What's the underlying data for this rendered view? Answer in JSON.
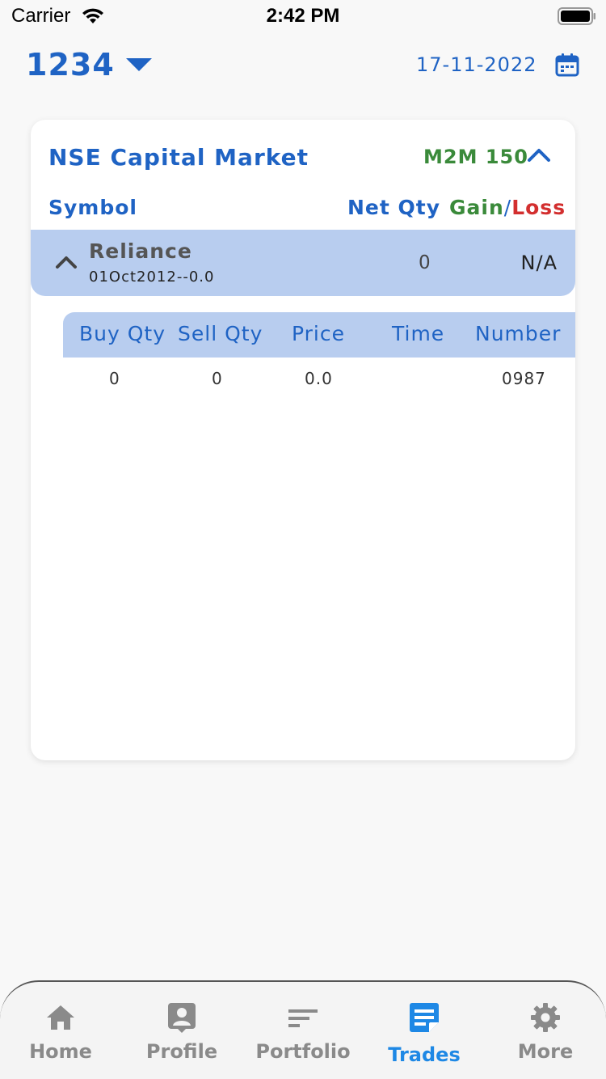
{
  "status_bar": {
    "carrier": "Carrier",
    "time": "2:42 PM"
  },
  "header": {
    "account": "1234",
    "date": "17-11-2022"
  },
  "card": {
    "title": "NSE Capital Market",
    "m2m": "M2M 150",
    "columns": {
      "symbol": "Symbol",
      "net_qty": "Net Qty",
      "gain": "Gain",
      "slash": "/",
      "loss": "Loss"
    },
    "row": {
      "symbol": "Reliance",
      "sub": "01Oct2012--0.0",
      "net_qty": "0",
      "gain_loss": "N/A"
    },
    "trade_columns": [
      "Buy Qty",
      "Sell Qty",
      "Price",
      "Time",
      "Number"
    ],
    "trade_values": [
      "0",
      "0",
      "0.0",
      "",
      "0987"
    ]
  },
  "tabs": [
    {
      "label": "Home",
      "icon": "home-icon"
    },
    {
      "label": "Profile",
      "icon": "profile-icon"
    },
    {
      "label": "Portfolio",
      "icon": "portfolio-icon"
    },
    {
      "label": "Trades",
      "icon": "trades-icon",
      "active": true
    },
    {
      "label": "More",
      "icon": "gear-icon"
    }
  ],
  "colors": {
    "primary": "#1f63c4",
    "gain": "#3a8a3a",
    "loss": "#d32f2f",
    "active_tab": "#1e88e5",
    "inactive_tab": "#8a8a8a",
    "row_highlight": "#b8cdef"
  }
}
